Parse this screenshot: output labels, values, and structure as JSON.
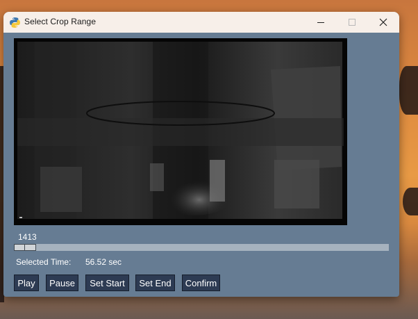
{
  "window": {
    "title": "Select Crop Range",
    "icon": "python-icon",
    "controls": [
      "minimize-icon",
      "maximize-icon",
      "close-icon"
    ]
  },
  "player": {
    "frame_number": "1413",
    "slider_position": 0.0,
    "selected_time_label": "Selected Time:",
    "selected_time_value": "56.52 sec"
  },
  "buttons": {
    "play": "Play",
    "pause": "Pause",
    "set_start": "Set Start",
    "set_end": "Set End",
    "confirm": "Confirm"
  },
  "colors": {
    "window_bg": "#667c93",
    "titlebar_bg": "#f7efe9",
    "button_bg": "#2d3b53",
    "slider_track": "#a6b2be"
  }
}
